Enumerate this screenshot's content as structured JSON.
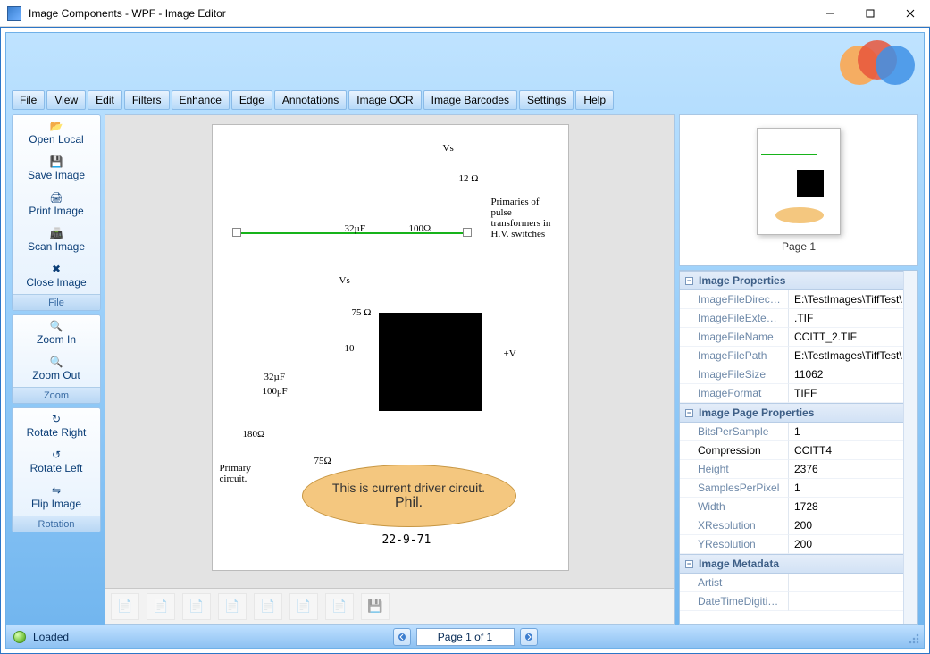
{
  "window": {
    "title": "Image Components - WPF - Image Editor"
  },
  "menu": [
    "File",
    "View",
    "Edit",
    "Filters",
    "Enhance",
    "Edge",
    "Annotations",
    "Image OCR",
    "Image Barcodes",
    "Settings",
    "Help"
  ],
  "toolbars": {
    "file": {
      "items": [
        "Open Local",
        "Save Image",
        "Print Image",
        "Scan Image",
        "Close Image"
      ],
      "footer": "File"
    },
    "zoom": {
      "items": [
        "Zoom In",
        "Zoom Out"
      ],
      "footer": "Zoom"
    },
    "rotation": {
      "items": [
        "Rotate Right",
        "Rotate Left",
        "Flip Image"
      ],
      "footer": "Rotation"
    }
  },
  "canvas": {
    "labels": {
      "vs_top": "Vs",
      "r12": "12 Ω",
      "primaries": "Primaries of pulse transformers in H.V. switches",
      "cap32_1": "32µF",
      "r100": "100Ω",
      "vs_mid": "Vs",
      "r75_1": "75 Ω",
      "l10": "10",
      "plusv": "+V",
      "cap32_2": "32µF",
      "cap100p": "100pF",
      "r180": "180Ω",
      "r75_2": "75Ω",
      "primary_circuit": "Primary circuit."
    },
    "annotation": {
      "line1": "This is current driver circuit.",
      "line2": "Phil."
    },
    "date": "22-9-71"
  },
  "thumbnail": {
    "caption": "Page 1"
  },
  "properties": {
    "sections": [
      {
        "title": "Image Properties",
        "rows": [
          {
            "k": "ImageFileDirectory",
            "v": "E:\\TestImages\\TiffTest\\"
          },
          {
            "k": "ImageFileExtension",
            "v": ".TIF"
          },
          {
            "k": "ImageFileName",
            "v": "CCITT_2.TIF"
          },
          {
            "k": "ImageFilePath",
            "v": "E:\\TestImages\\TiffTest\\"
          },
          {
            "k": "ImageFileSize",
            "v": "11062"
          },
          {
            "k": "ImageFormat",
            "v": "TIFF"
          }
        ]
      },
      {
        "title": "Image Page Properties",
        "rows": [
          {
            "k": "BitsPerSample",
            "v": "1"
          },
          {
            "k": "Compression",
            "v": "CCITT4",
            "selected": true
          },
          {
            "k": "Height",
            "v": "2376"
          },
          {
            "k": "SamplesPerPixel",
            "v": "1"
          },
          {
            "k": "Width",
            "v": "1728"
          },
          {
            "k": "XResolution",
            "v": "200"
          },
          {
            "k": "YResolution",
            "v": "200"
          }
        ]
      },
      {
        "title": "Image Metadata",
        "rows": [
          {
            "k": "Artist",
            "v": ""
          },
          {
            "k": "DateTimeDigitized",
            "v": ""
          }
        ]
      }
    ]
  },
  "status": {
    "text": "Loaded",
    "pager": "Page 1 of 1"
  }
}
